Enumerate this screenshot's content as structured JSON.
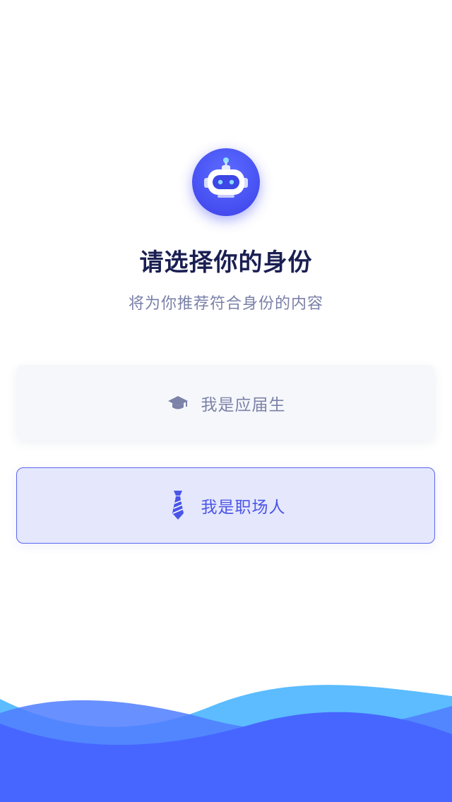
{
  "header": {
    "title": "请选择你的身份",
    "subtitle": "将为你推荐符合身份的内容",
    "avatar_icon": "robot-icon"
  },
  "options": [
    {
      "id": "graduate",
      "label": "我是应届生",
      "icon": "graduation-cap-icon",
      "selected": false
    },
    {
      "id": "professional",
      "label": "我是职场人",
      "icon": "necktie-icon",
      "selected": true
    }
  ],
  "colors": {
    "title": "#1a1f52",
    "subtitle": "#7a80a8",
    "accent": "#4a55e8",
    "selected_bg": "#e5e7fc",
    "unselected_bg": "#f6f7fb",
    "wave_light": "#5cbcff",
    "wave_dark": "#4766ff"
  }
}
